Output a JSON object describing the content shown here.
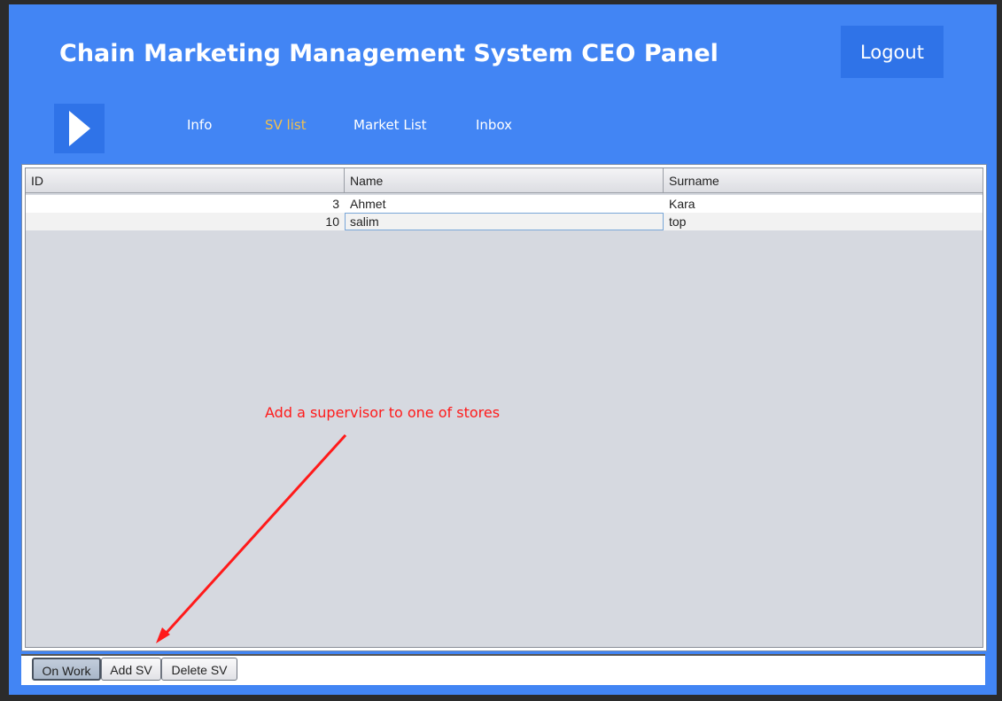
{
  "header": {
    "title": "Chain Marketing Management System CEO Panel",
    "logout_label": "Logout"
  },
  "nav": {
    "items": [
      {
        "label": "Info"
      },
      {
        "label": "SV list"
      },
      {
        "label": "Market List"
      },
      {
        "label": "Inbox"
      }
    ],
    "active": "SV list"
  },
  "table": {
    "columns": [
      "ID",
      "Name",
      "Surname"
    ],
    "rows": [
      {
        "id": "3",
        "name": "Ahmet",
        "surname": "Kara"
      },
      {
        "id": "10",
        "name": "salim",
        "surname": "top"
      }
    ]
  },
  "annotation": {
    "text": "Add a supervisor to one of stores",
    "color": "#ff1a1a"
  },
  "tabs": [
    {
      "label": "On Work"
    },
    {
      "label": "Add SV"
    },
    {
      "label": "Delete SV"
    }
  ],
  "colors": {
    "window_bg": "#4285f4",
    "button_bg": "#2f73e8",
    "active_nav": "#f0c050"
  }
}
